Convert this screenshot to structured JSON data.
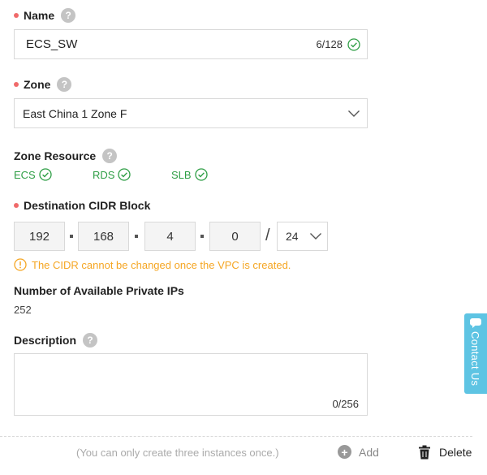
{
  "name_field": {
    "label": "Name",
    "help": "?",
    "value": "ECS_SW",
    "count": "6/128"
  },
  "zone_field": {
    "label": "Zone",
    "help": "?",
    "value": "East China 1 Zone F"
  },
  "zone_resource": {
    "label": "Zone Resource",
    "help": "?",
    "items": [
      {
        "label": "ECS"
      },
      {
        "label": "RDS"
      },
      {
        "label": "SLB"
      }
    ]
  },
  "cidr": {
    "label": "Destination CIDR Block",
    "octets": [
      "192",
      "168",
      "4",
      "0"
    ],
    "slash": "/",
    "mask": "24",
    "warning": "The CIDR cannot be changed once the VPC is created."
  },
  "available_ips": {
    "label": "Number of Available Private IPs",
    "value": "252"
  },
  "description": {
    "label": "Description",
    "help": "?",
    "count": "0/256"
  },
  "footer": {
    "note": "(You can only create three instances once.)",
    "add_label": "Add",
    "delete_label": "Delete"
  },
  "contact": {
    "label": "Contact Us"
  },
  "colors": {
    "required_dot": "#f06a6a",
    "success_green": "#2e9e45",
    "warning_orange": "#f5a623",
    "contact_bg": "#5ec4e3"
  },
  "icons": {
    "help": "question-circle-icon",
    "valid": "check-circle-icon",
    "dropdown": "chevron-down-icon",
    "warning": "exclamation-circle-icon",
    "add": "plus-circle-icon",
    "delete": "trash-icon",
    "contact": "chat-icon"
  }
}
